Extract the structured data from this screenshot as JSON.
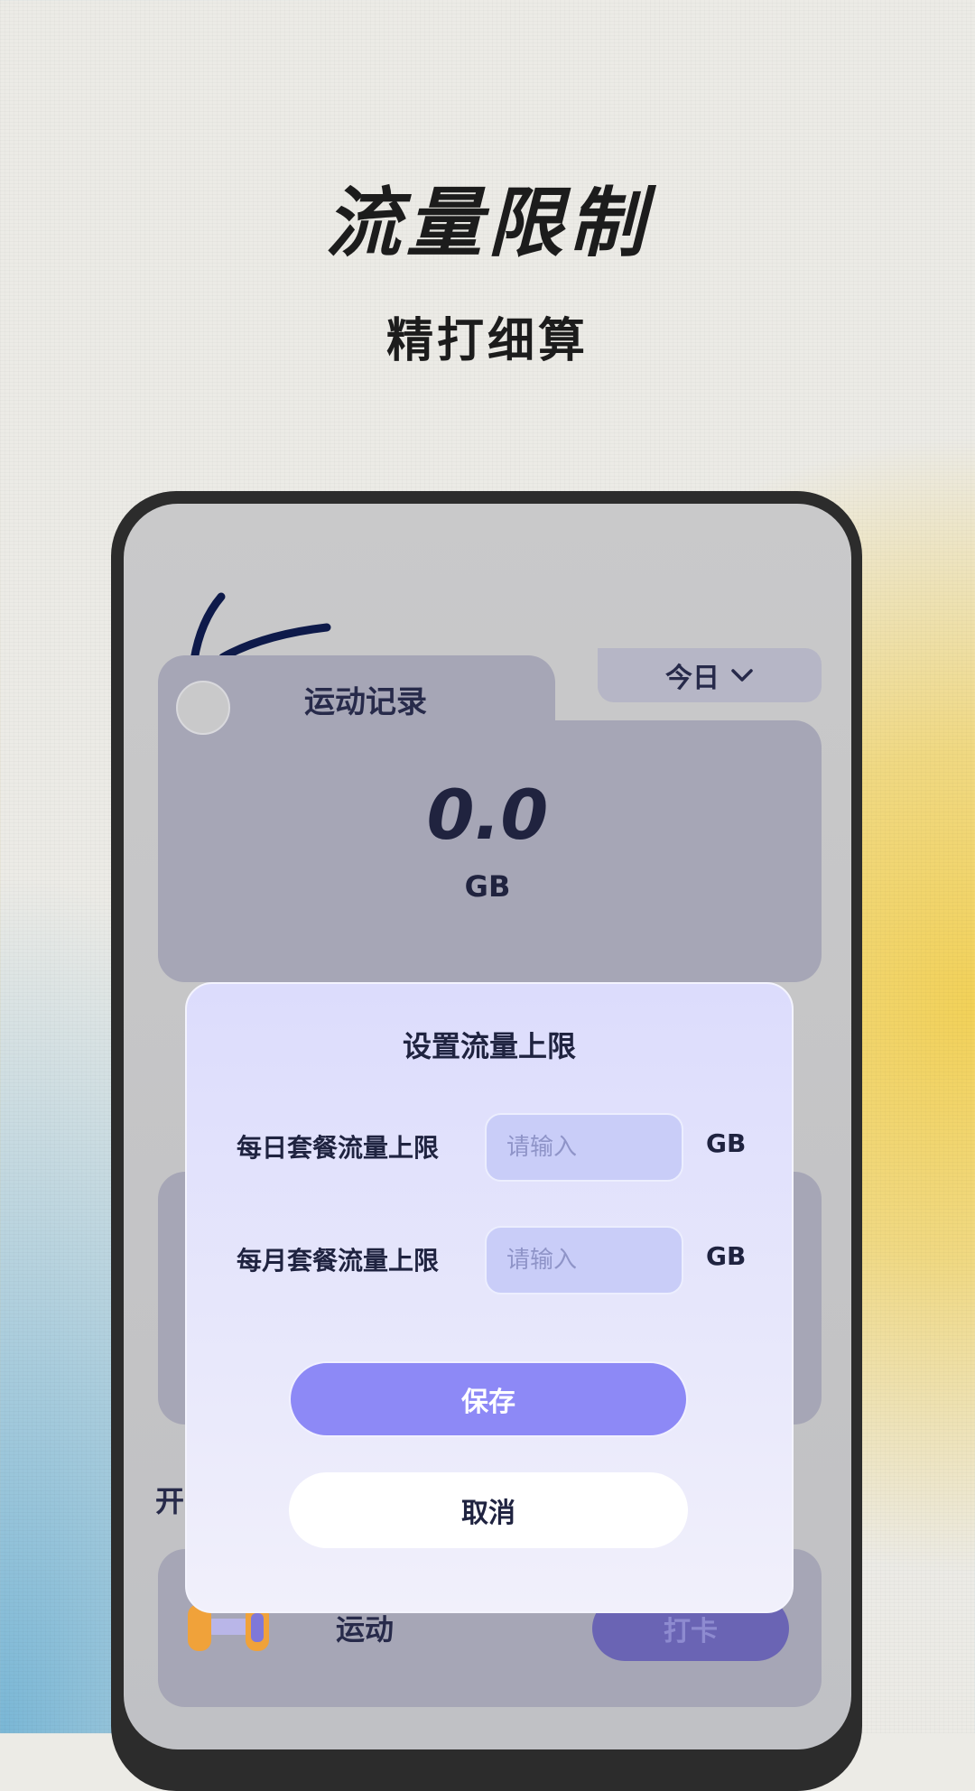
{
  "hero": {
    "title": "流量限制",
    "subtitle": "精打细算"
  },
  "background_screen": {
    "card": {
      "title": "运动记录",
      "period": "今日",
      "value": "0.0",
      "unit": "GB"
    },
    "section_label_partial": "开",
    "exercise_item": {
      "label": "运动",
      "button": "打卡"
    }
  },
  "dialog": {
    "title": "设置流量上限",
    "rows": [
      {
        "label": "每日套餐流量上限",
        "placeholder": "请输入",
        "value": "",
        "unit": "GB"
      },
      {
        "label": "每月套餐流量上限",
        "placeholder": "请输入",
        "value": "",
        "unit": "GB"
      }
    ],
    "save_label": "保存",
    "cancel_label": "取消"
  },
  "colors": {
    "accent": "#8d89f6",
    "dialog_bg": "#dcdcfc",
    "text_dark": "#1f2340",
    "warm_glow": "#f2d158",
    "cool_glow": "#7ab7d6"
  },
  "icons": [
    "chevron-down-icon",
    "dumbbell-icon",
    "pen-stroke-decoration"
  ]
}
